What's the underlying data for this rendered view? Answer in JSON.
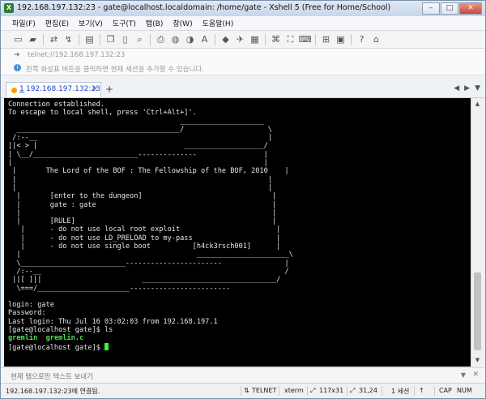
{
  "window": {
    "title": "192.168.197.132:23 - gate@localhost.localdomain: /home/gate - Xshell 5 (Free for Home/School)",
    "buttons": {
      "minimize": "–",
      "maximize": "□",
      "close": "✕"
    }
  },
  "menu": [
    "파일(F)",
    "편집(E)",
    "보기(V)",
    "도구(T)",
    "탭(B)",
    "창(W)",
    "도움말(H)"
  ],
  "address": {
    "value": "telnet://192.168.197.132:23"
  },
  "hint": {
    "text": "왼쪽 화살표 버튼을 클릭하면 현재 세션을 추가할 수 있습니다."
  },
  "tab": {
    "number": "1",
    "label": " 192.168.197.132:23",
    "close": "×",
    "add": "+",
    "nav_prev": "◀",
    "nav_next": "▶",
    "nav_menu": "▼"
  },
  "terminal": {
    "lines": [
      "Connection established.",
      "To escape to local shell, press 'Ctrl+Alt+]'.",
      "                                         ____________________",
      "  _______________________________________/                    \\",
      " /:--__                                                       |",
      "||< > |                                   ___________________/",
      "| \\__/_________________________--------------                |",
      "|                                                            |",
      " |       The Lord of the BOF : The Fellowship of the BOF, 2010    |",
      " |                                                            |",
      " |                                                            |",
      "  |       [enter to the dungeon]                               |",
      "  |       gate : gate                                          |",
      "  |                                                            |",
      "  |       [RULE]                                               |",
      "   |      - do not use local root exploit                       |",
      "   |      - do not use LD_PRELOAD to my-pass                    |",
      "   |      - do not use single boot          [h4ck3rsch001]      |",
      "  |                                          ______________________\\",
      "  \\_________________________-----------------------               |",
      "  /:--__                                                          /",
      " ||[ ]||                        ________________________________/",
      "  \\===/______________________------------------------",
      "",
      "login: gate",
      "Password:",
      "Last login: Thu Jul 16 03:02:03 from 192.168.197.1",
      "[gate@localhost gate]$ ls"
    ],
    "ls_output": "gremlin  gremlin.c",
    "prompt": "[gate@localhost gate]$ "
  },
  "sendbar": {
    "text": "현재 탭으로만 텍스트 보내기"
  },
  "status": {
    "connection": "192.168.197.132:23에 연결됨.",
    "protocol": "TELNET",
    "term": "xterm",
    "size": "117x31",
    "position": "31,24",
    "sessions": "1 세션",
    "caps": "CAP",
    "num": "NUM"
  }
}
